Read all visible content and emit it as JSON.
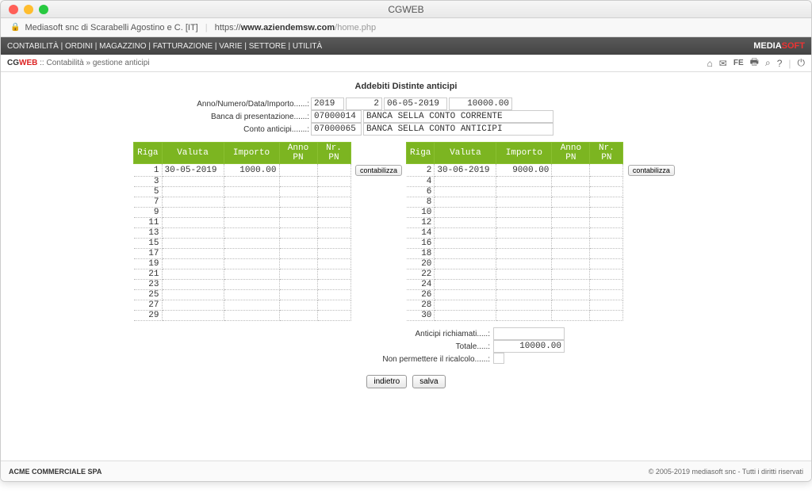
{
  "window": {
    "title": "CGWEB"
  },
  "url": {
    "identity": "Mediasoft snc di Scarabelli Agostino e C. [IT]",
    "protocol": "https://",
    "host": "www.aziendemsw.com",
    "path": "/home.php"
  },
  "nav": {
    "items": [
      "CONTABILITÀ",
      "ORDINI",
      "MAGAZZINO",
      "FATTURAZIONE",
      "VARIE",
      "SETTORE",
      "UTILITÀ"
    ],
    "brand_pre": "MEDIA",
    "brand_suf": "SOFT"
  },
  "breadcrumb": {
    "app_pre": "CG",
    "app_suf": "WEB",
    "sep": " :: ",
    "path": "Contabilità » gestione anticipi"
  },
  "toolbar": {
    "home": "⌂",
    "mail": "✉",
    "fe": "FE",
    "print": "🖶",
    "search": "⌕",
    "help": "?",
    "sep": "|",
    "power": "⏻"
  },
  "page": {
    "title": "Addebiti Distinte anticipi"
  },
  "form": {
    "r1_label": "Anno/Numero/Data/Importo......:",
    "anno": "2019",
    "numero": "2",
    "data": "06-05-2019",
    "importo": "10000.00",
    "r2_label": "Banca di presentazione......:",
    "banca_cod": "07000014",
    "banca_desc": "BANCA SELLA CONTO CORRENTE",
    "r3_label": "Conto anticipi.......:",
    "conto_cod": "07000065",
    "conto_desc": "BANCA SELLA CONTO ANTICIPI"
  },
  "headers": {
    "riga": "Riga",
    "valuta": "Valuta",
    "importo": "Importo",
    "annopn": "Anno PN",
    "nrpn": "Nr. PN"
  },
  "left_rows": [
    {
      "riga": "1",
      "valuta": "30-05-2019",
      "importo": "1000.00",
      "annopn": "",
      "nrpn": ""
    },
    {
      "riga": "3"
    },
    {
      "riga": "5"
    },
    {
      "riga": "7"
    },
    {
      "riga": "9"
    },
    {
      "riga": "11"
    },
    {
      "riga": "13"
    },
    {
      "riga": "15"
    },
    {
      "riga": "17"
    },
    {
      "riga": "19"
    },
    {
      "riga": "21"
    },
    {
      "riga": "23"
    },
    {
      "riga": "25"
    },
    {
      "riga": "27"
    },
    {
      "riga": "29"
    }
  ],
  "right_rows": [
    {
      "riga": "2",
      "valuta": "30-06-2019",
      "importo": "9000.00",
      "annopn": "",
      "nrpn": ""
    },
    {
      "riga": "4"
    },
    {
      "riga": "6"
    },
    {
      "riga": "8"
    },
    {
      "riga": "10"
    },
    {
      "riga": "12"
    },
    {
      "riga": "14"
    },
    {
      "riga": "16"
    },
    {
      "riga": "18"
    },
    {
      "riga": "20"
    },
    {
      "riga": "22"
    },
    {
      "riga": "24"
    },
    {
      "riga": "26"
    },
    {
      "riga": "28"
    },
    {
      "riga": "30"
    }
  ],
  "btn_contabilizza": "contabilizza",
  "summary": {
    "anticipi_label": "Anticipi richiamati.....:",
    "anticipi_val": "",
    "totale_label": "Totale.....:",
    "totale_val": "10000.00",
    "ricalcolo_label": "Non permettere il ricalcolo......:"
  },
  "actions": {
    "indietro": "indietro",
    "salva": "salva"
  },
  "footer": {
    "company": "ACME COMMERCIALE SPA",
    "copyright": "© 2005-2019 mediasoft snc - Tutti i diritti riservati"
  }
}
